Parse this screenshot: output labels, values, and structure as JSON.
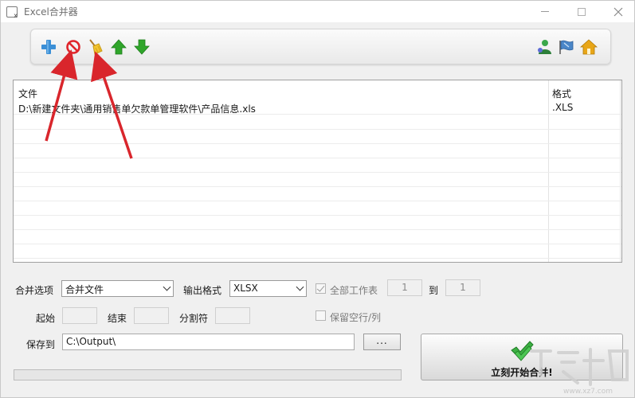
{
  "window": {
    "title": "Excel合并器"
  },
  "toolbar": {
    "icons": [
      "add-icon",
      "remove-icon",
      "clear-icon",
      "move-up-icon",
      "move-down-icon",
      "user-icon",
      "flag-icon",
      "home-icon"
    ],
    "colors": {
      "add": "#3b8fd6",
      "remove": "#e0242a",
      "arrow": "#2fa52a",
      "home": "#e8a618"
    }
  },
  "file_list": {
    "columns": [
      "文件",
      "格式"
    ],
    "rows": [
      {
        "file": "D:\\新建文件夹\\通用销售单欠款单管理软件\\产品信息.xls",
        "format": ".XLS"
      }
    ]
  },
  "options": {
    "merge_option_label": "合并选项",
    "merge_option_value": "合并文件",
    "output_format_label": "输出格式",
    "output_format_value": "XLSX",
    "all_sheets_label": "全部工作表",
    "all_sheets_checked": true,
    "sheet_from": "1",
    "to_label": "到",
    "sheet_to": "1",
    "start_label": "起始",
    "end_label": "结束",
    "delimiter_label": "分割符",
    "keep_empty_label": "保留空行/列",
    "keep_empty_checked": false,
    "save_to_label": "保存到",
    "save_to_value": "C:\\Output\\",
    "browse_label": "..."
  },
  "progress": {
    "value": 0
  },
  "merge_button": {
    "label": "立刻开始合并!"
  },
  "watermark": {
    "text": "www.xz7.com"
  }
}
